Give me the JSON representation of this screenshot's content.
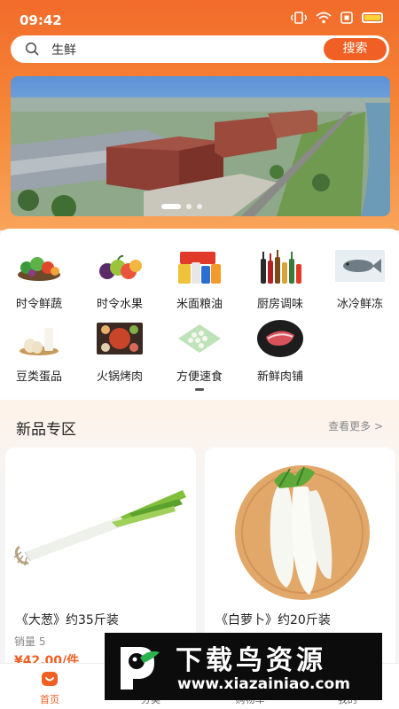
{
  "status": {
    "time": "09:42"
  },
  "search": {
    "query": "生鲜",
    "button_label": "搜索"
  },
  "banner": {
    "slide_count": 3,
    "active_slide": 1
  },
  "categories": [
    {
      "label": "时令鲜蔬",
      "icon": "vegetables-icon"
    },
    {
      "label": "时令水果",
      "icon": "fruits-icon"
    },
    {
      "label": "米面粮油",
      "icon": "grain-oil-icon"
    },
    {
      "label": "厨房调味",
      "icon": "seasoning-icon"
    },
    {
      "label": "冰冷鲜冻",
      "icon": "frozen-fish-icon"
    },
    {
      "label": "豆类蛋品",
      "icon": "eggs-icon"
    },
    {
      "label": "火锅烤肉",
      "icon": "hotpot-icon"
    },
    {
      "label": "方便速食",
      "icon": "dumplings-icon"
    },
    {
      "label": "新鲜肉铺",
      "icon": "meat-icon"
    }
  ],
  "new_products": {
    "title": "新品专区",
    "more_label": "查看更多 >",
    "items": [
      {
        "name": "《大葱》约35斤装",
        "sales": "销量 5",
        "price": "¥42.00/件"
      },
      {
        "name": "《白萝卜》约20斤装",
        "sales": "",
        "price": ""
      }
    ]
  },
  "tabbar": [
    {
      "label": "首页",
      "icon": "home-icon",
      "active": true
    },
    {
      "label": "分类",
      "icon": "category-icon",
      "active": false
    },
    {
      "label": "购物车",
      "icon": "cart-icon",
      "active": false
    },
    {
      "label": "我的",
      "icon": "profile-icon",
      "active": false
    }
  ],
  "watermark": {
    "title": "下载鸟资源",
    "url": "www.xiazainiao.com"
  },
  "colors": {
    "accent": "#f05f23",
    "header_top": "#f26b2a",
    "header_bottom": "#f8a45a"
  }
}
